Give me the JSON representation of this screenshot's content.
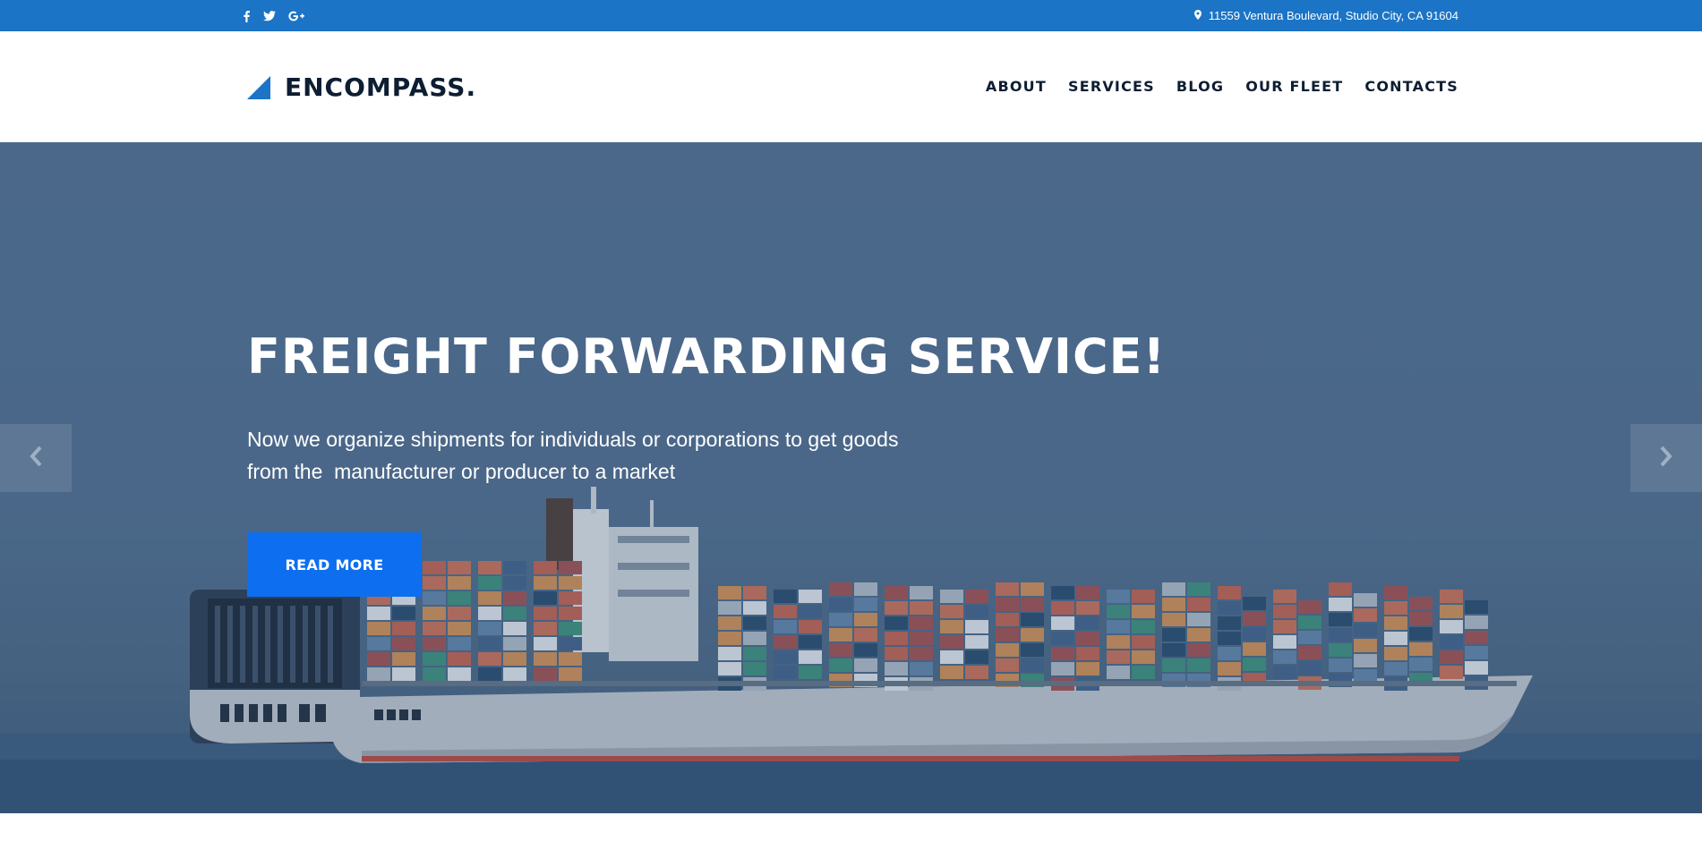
{
  "topbar": {
    "social": [
      {
        "name": "facebook-icon",
        "glyph": "f"
      },
      {
        "name": "twitter-icon",
        "glyph": "t"
      },
      {
        "name": "google-plus-icon",
        "glyph": "G+"
      }
    ],
    "address_icon": "map-pin-icon",
    "address": "11559 Ventura Boulevard, Studio City, CA 91604"
  },
  "header": {
    "logo_text": "ENCOMPASS.",
    "nav": [
      "ABOUT",
      "SERVICES",
      "BLOG",
      "OUR FLEET",
      "CONTACTS"
    ]
  },
  "hero": {
    "title": "FREIGHT FORWARDING SERVICE!",
    "subtitle_lines": [
      "Now we organize shipments for individuals or corporations to get goods",
      "from the  manufacturer or producer to a market"
    ],
    "button_label": "READ MORE",
    "prev_icon": "chevron-left-icon",
    "next_icon": "chevron-right-icon"
  },
  "colors": {
    "topbar": "#1b74c5",
    "accent": "#0d6ff0",
    "logo_mark": "#1b74c5",
    "text_dark": "#0d1e33",
    "hero_overlay": "#4f6b8b"
  }
}
